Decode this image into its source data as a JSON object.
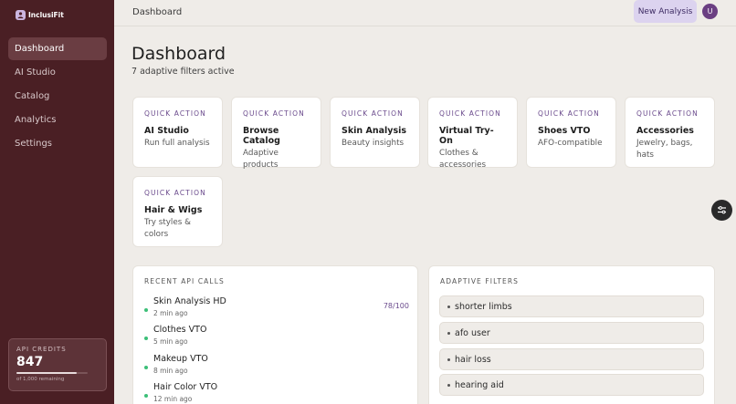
{
  "brand": {
    "name": "InclusiFit"
  },
  "sidebar": {
    "items": [
      {
        "label": "Dashboard"
      },
      {
        "label": "AI Studio"
      },
      {
        "label": "Catalog"
      },
      {
        "label": "Analytics"
      },
      {
        "label": "Settings"
      }
    ],
    "credits": {
      "label": "API CREDITS",
      "value": "847",
      "sub": "of 1,000 remaining",
      "fraction": 0.847
    }
  },
  "header": {
    "breadcrumb": "Dashboard",
    "new_button": "New Analysis",
    "avatar_initial": "U"
  },
  "page": {
    "title": "Dashboard",
    "subtitle": "7 adaptive filters active"
  },
  "quick_actions": [
    {
      "label": "QUICK ACTION",
      "title": "AI Studio",
      "desc": "Run full analysis"
    },
    {
      "label": "QUICK ACTION",
      "title": "Browse Catalog",
      "desc": "Adaptive products"
    },
    {
      "label": "QUICK ACTION",
      "title": "Skin Analysis",
      "desc": "Beauty insights"
    },
    {
      "label": "QUICK ACTION",
      "title": "Virtual Try-On",
      "desc": "Clothes & accessories"
    },
    {
      "label": "QUICK ACTION",
      "title": "Shoes VTO",
      "desc": "AFO-compatible"
    },
    {
      "label": "QUICK ACTION",
      "title": "Accessories",
      "desc": "Jewelry, bags, hats"
    },
    {
      "label": "QUICK ACTION",
      "title": "Hair & Wigs",
      "desc": "Try styles & colors"
    }
  ],
  "recent_calls": {
    "title": "RECENT API CALLS",
    "items": [
      {
        "name": "Skin Analysis HD",
        "time": "2 min ago",
        "score": "78/100"
      },
      {
        "name": "Clothes VTO",
        "time": "5 min ago",
        "score": ""
      },
      {
        "name": "Makeup VTO",
        "time": "8 min ago",
        "score": ""
      },
      {
        "name": "Hair Color VTO",
        "time": "12 min ago",
        "score": ""
      }
    ]
  },
  "adaptive_filters": {
    "title": "ADAPTIVE FILTERS",
    "items": [
      {
        "label": "shorter limbs"
      },
      {
        "label": "afo user"
      },
      {
        "label": "hair loss"
      },
      {
        "label": "hearing aid"
      }
    ]
  },
  "colors": {
    "sidebar": "#4a1f24",
    "accent": "#6a4a8c",
    "status_ok": "#3cbf78",
    "background": "#efece8"
  }
}
